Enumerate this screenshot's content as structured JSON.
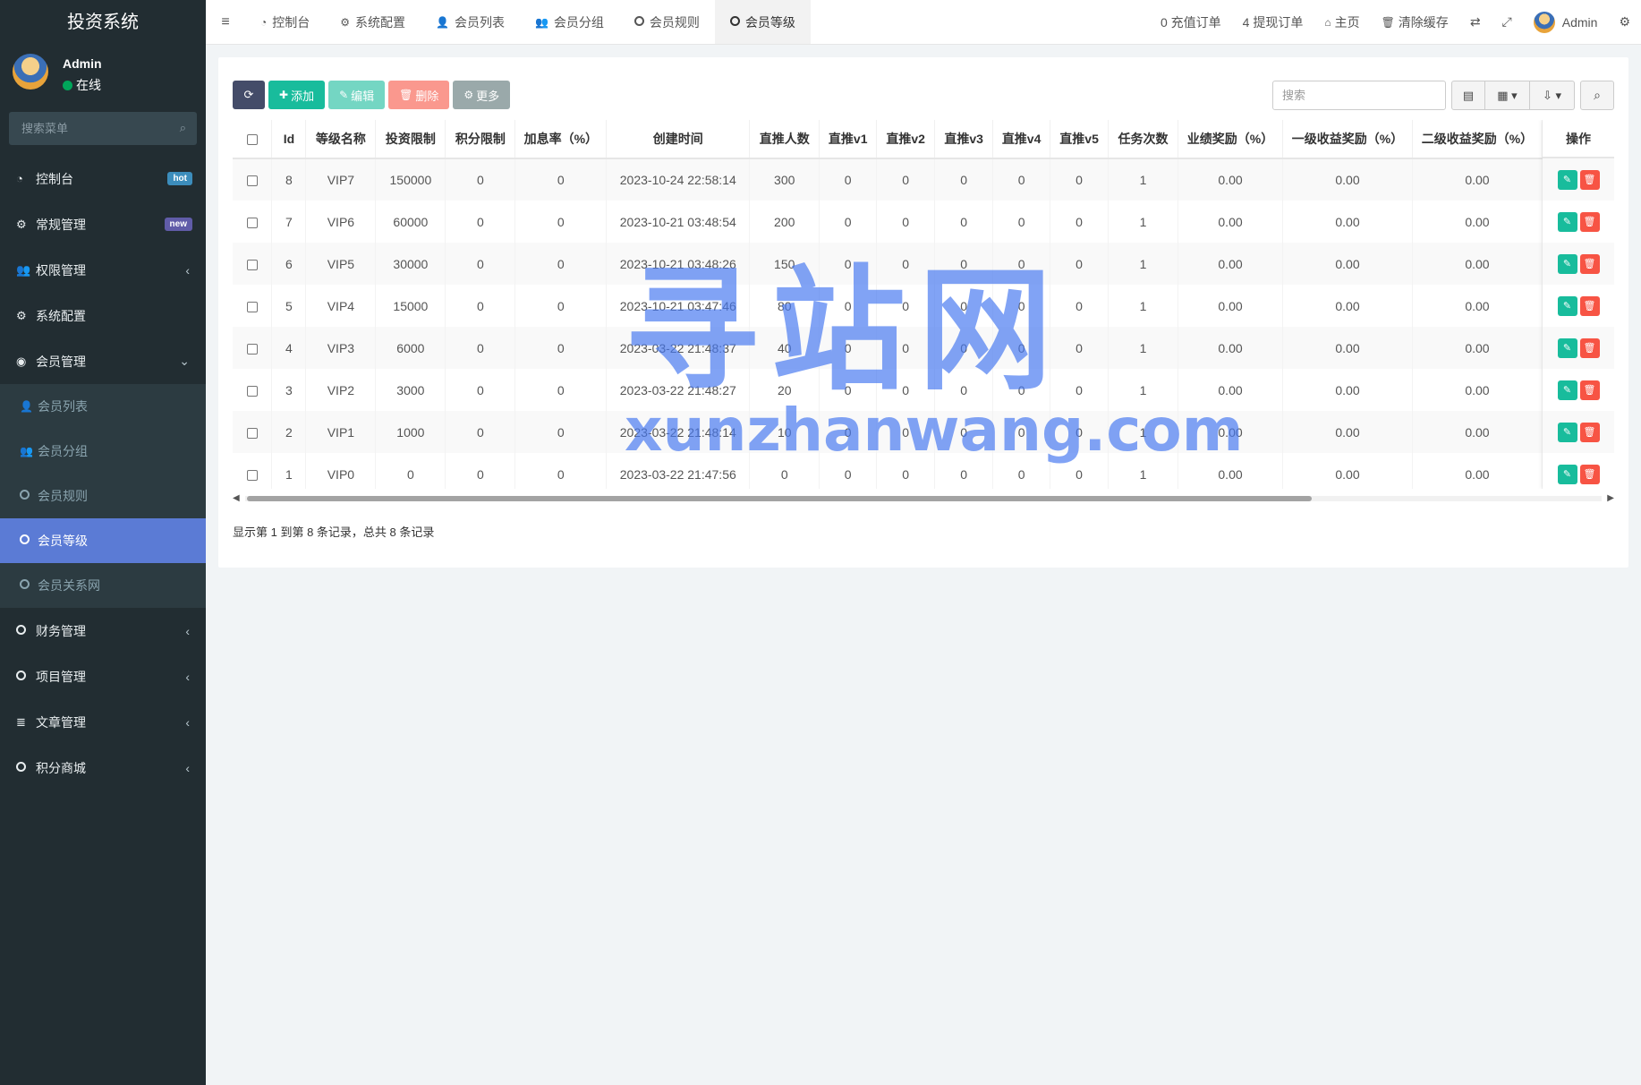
{
  "app": {
    "title": "投资系统"
  },
  "user": {
    "name": "Admin",
    "status": "在线"
  },
  "sidebar": {
    "search_placeholder": "搜索菜单",
    "items": [
      {
        "label": "控制台",
        "icon": "dashboard-icon",
        "badge": "hot",
        "badge_color": "#3c8dbc"
      },
      {
        "label": "常规管理",
        "icon": "cogs-icon",
        "badge": "new",
        "badge_color": "#605ca8"
      },
      {
        "label": "权限管理",
        "icon": "users-icon",
        "arrow": "‹"
      },
      {
        "label": "系统配置",
        "icon": "gear-icon"
      },
      {
        "label": "会员管理",
        "icon": "user-circle-icon",
        "arrow": "⌄"
      }
    ],
    "submenu": [
      {
        "label": "会员列表",
        "icon": "user-icon"
      },
      {
        "label": "会员分组",
        "icon": "users-icon"
      },
      {
        "label": "会员规则",
        "icon": "circle-icon"
      },
      {
        "label": "会员等级",
        "icon": "circle-icon",
        "active": true
      },
      {
        "label": "会员关系网",
        "icon": "circle-icon"
      }
    ],
    "items_after": [
      {
        "label": "财务管理",
        "icon": "circle-icon",
        "arrow": "‹"
      },
      {
        "label": "项目管理",
        "icon": "circle-icon",
        "arrow": "‹"
      },
      {
        "label": "文章管理",
        "icon": "list-icon",
        "arrow": "‹"
      },
      {
        "label": "积分商城",
        "icon": "circle-icon",
        "arrow": "‹"
      }
    ]
  },
  "topbar": {
    "tabs": [
      {
        "label": "控制台",
        "icon": "dashboard-icon"
      },
      {
        "label": "系统配置",
        "icon": "gear-icon"
      },
      {
        "label": "会员列表",
        "icon": "user-icon"
      },
      {
        "label": "会员分组",
        "icon": "users-icon"
      },
      {
        "label": "会员规则",
        "icon": "circle-icon"
      },
      {
        "label": "会员等级",
        "icon": "circle-icon",
        "active": true
      }
    ],
    "recharge": "0 充值订单",
    "withdraw": "4 提现订单",
    "home": "主页",
    "clear_cache": "清除缓存",
    "admin": "Admin"
  },
  "toolbar": {
    "add": "添加",
    "edit": "编辑",
    "delete": "删除",
    "more": "更多",
    "search_placeholder": "搜索"
  },
  "table": {
    "columns": [
      "Id",
      "等级名称",
      "投资限制",
      "积分限制",
      "加息率（%）",
      "创建时间",
      "直推人数",
      "直推v1",
      "直推v2",
      "直推v3",
      "直推v4",
      "直推v5",
      "任务次数",
      "业绩奖励（%）",
      "一级收益奖励（%）",
      "二级收益奖励（%）"
    ],
    "action_header": "操作",
    "rows": [
      [
        "8",
        "VIP7",
        "150000",
        "0",
        "0",
        "2023-10-24 22:58:14",
        "300",
        "0",
        "0",
        "0",
        "0",
        "0",
        "1",
        "0.00",
        "0.00",
        "0.00"
      ],
      [
        "7",
        "VIP6",
        "60000",
        "0",
        "0",
        "2023-10-21 03:48:54",
        "200",
        "0",
        "0",
        "0",
        "0",
        "0",
        "1",
        "0.00",
        "0.00",
        "0.00"
      ],
      [
        "6",
        "VIP5",
        "30000",
        "0",
        "0",
        "2023-10-21 03:48:26",
        "150",
        "0",
        "0",
        "0",
        "0",
        "0",
        "1",
        "0.00",
        "0.00",
        "0.00"
      ],
      [
        "5",
        "VIP4",
        "15000",
        "0",
        "0",
        "2023-10-21 03:47:46",
        "80",
        "0",
        "0",
        "0",
        "0",
        "0",
        "1",
        "0.00",
        "0.00",
        "0.00"
      ],
      [
        "4",
        "VIP3",
        "6000",
        "0",
        "0",
        "2023-03-22 21:48:37",
        "40",
        "0",
        "0",
        "0",
        "0",
        "0",
        "1",
        "0.00",
        "0.00",
        "0.00"
      ],
      [
        "3",
        "VIP2",
        "3000",
        "0",
        "0",
        "2023-03-22 21:48:27",
        "20",
        "0",
        "0",
        "0",
        "0",
        "0",
        "1",
        "0.00",
        "0.00",
        "0.00"
      ],
      [
        "2",
        "VIP1",
        "1000",
        "0",
        "0",
        "2023-03-22 21:48:14",
        "10",
        "0",
        "0",
        "0",
        "0",
        "0",
        "1",
        "0.00",
        "0.00",
        "0.00"
      ],
      [
        "1",
        "VIP0",
        "0",
        "0",
        "0",
        "2023-03-22 21:47:56",
        "0",
        "0",
        "0",
        "0",
        "0",
        "0",
        "1",
        "0.00",
        "0.00",
        "0.00"
      ]
    ]
  },
  "pagination": {
    "summary": "显示第 1 到第 8 条记录，总共 8 条记录"
  },
  "watermark": {
    "cn": "寻站网",
    "en": "xunzhanwang.com"
  }
}
